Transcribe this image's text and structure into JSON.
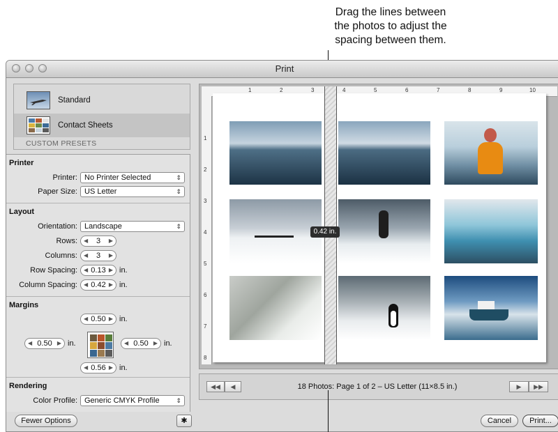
{
  "callout": {
    "line1": "Drag the lines between",
    "line2": "the photos to adjust the",
    "line3": "spacing between them."
  },
  "window": {
    "title": "Print"
  },
  "presets": {
    "items": [
      {
        "label": "Standard",
        "icon": "jet-thumbnail-icon"
      },
      {
        "label": "Contact Sheets",
        "icon": "contact-sheet-thumbnail-icon",
        "selected": true
      }
    ],
    "custom_header": "CUSTOM PRESETS"
  },
  "printer": {
    "header": "Printer",
    "printer_label": "Printer:",
    "printer_value": "No Printer Selected",
    "paper_label": "Paper Size:",
    "paper_value": "US Letter"
  },
  "layout": {
    "header": "Layout",
    "orientation_label": "Orientation:",
    "orientation_value": "Landscape",
    "rows_label": "Rows:",
    "rows_value": "3",
    "columns_label": "Columns:",
    "columns_value": "3",
    "row_spacing_label": "Row Spacing:",
    "row_spacing_value": "0.13",
    "column_spacing_label": "Column Spacing:",
    "column_spacing_value": "0.42",
    "unit": "in."
  },
  "margins": {
    "header": "Margins",
    "top": "0.50",
    "left": "0.50",
    "right": "0.50",
    "bottom": "0.56",
    "unit": "in."
  },
  "rendering": {
    "header": "Rendering",
    "color_profile_label": "Color Profile:",
    "color_profile_value": "Generic CMYK Profile"
  },
  "buttons": {
    "fewer_options": "Fewer Options",
    "gear": "gear-icon",
    "cancel": "Cancel",
    "print": "Print..."
  },
  "preview": {
    "ruler_top": [
      "1",
      "2",
      "3",
      "4",
      "5",
      "6",
      "7",
      "8",
      "9",
      "10"
    ],
    "ruler_left": [
      "1",
      "2",
      "3",
      "4",
      "5",
      "6",
      "7",
      "8"
    ],
    "spacing_tooltip": "0.42 in.",
    "photos": [
      "ocean-mountains-photo",
      "ocean-mountains-photo",
      "kayaker-photo",
      "snow-expedition-line-photo",
      "hiker-snow-photo",
      "iceberg-photo",
      "glacier-photo",
      "penguins-photo",
      "ship-photo"
    ]
  },
  "navigation": {
    "status": "18 Photos: Page 1 of 2 – US Letter (11×8.5 in.)",
    "first_icon": "rewind-icon",
    "prev_icon": "previous-icon",
    "next_icon": "next-icon",
    "last_icon": "fast-forward-icon"
  },
  "colors": {
    "accent_tooltip": "#2d2d2d",
    "window_bg": "#dcdcdc"
  }
}
